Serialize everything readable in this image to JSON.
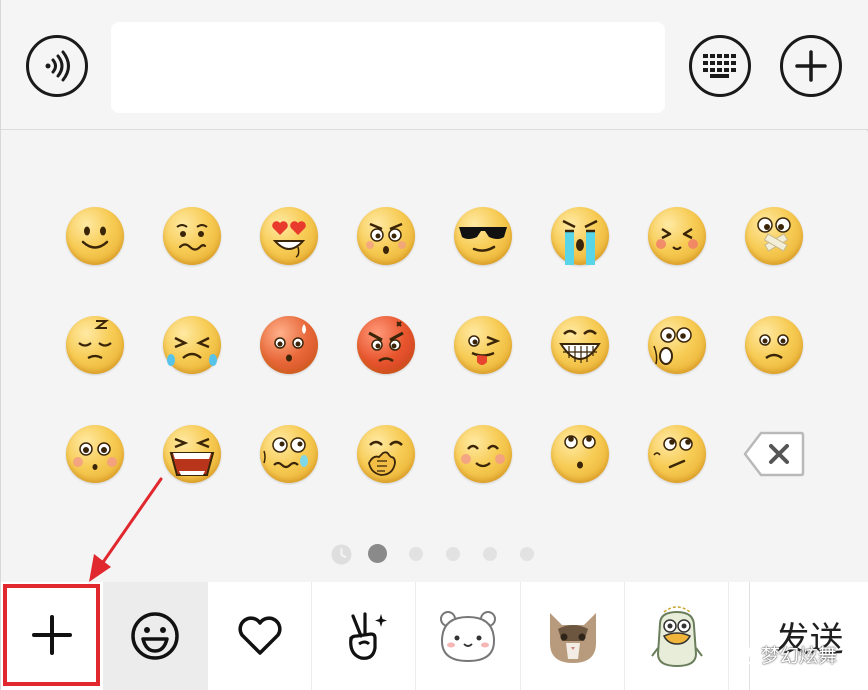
{
  "input": {
    "value": "",
    "placeholder": ""
  },
  "top_buttons": {
    "voice": "voice-wave-icon",
    "keyboard": "keyboard-icon",
    "more": "plus-circle-icon"
  },
  "emoji_rows": [
    [
      "smile",
      "awkward",
      "heart-eyes",
      "angry-frown",
      "cool-sunglasses",
      "crying-tears",
      "shy",
      "shush-tape"
    ],
    [
      "sleepy",
      "loud-cry",
      "embarrassed-red",
      "furious-red",
      "tongue-wink",
      "grin-teeth",
      "surprised",
      "sad"
    ],
    [
      "blush-stare",
      "wail",
      "sweat-nervous",
      "hand-cover-laugh",
      "happy-blush",
      "rolling-eyes",
      "doubt",
      "delete-key"
    ]
  ],
  "pagination": {
    "total": 6,
    "current": 2,
    "recent_icon": "clock-icon"
  },
  "bottom_tabs": [
    {
      "name": "add-sticker",
      "icon": "plus-icon"
    },
    {
      "name": "emoji",
      "icon": "smiley-face-icon"
    },
    {
      "name": "favorites",
      "icon": "heart-icon"
    },
    {
      "name": "gestures",
      "icon": "victory-hand-sparkle-icon"
    },
    {
      "name": "sticker-pack-bear",
      "icon": "white-bear-sticker-icon"
    },
    {
      "name": "sticker-pack-cat",
      "icon": "cat-photo-sticker-icon"
    },
    {
      "name": "sticker-pack-duck",
      "icon": "duck-sticker-icon"
    }
  ],
  "send_label": "发送",
  "watermark": "梦幻炫舞",
  "colors": {
    "highlight": "#e0282e",
    "emoji_yellow": "#f7cc55"
  }
}
